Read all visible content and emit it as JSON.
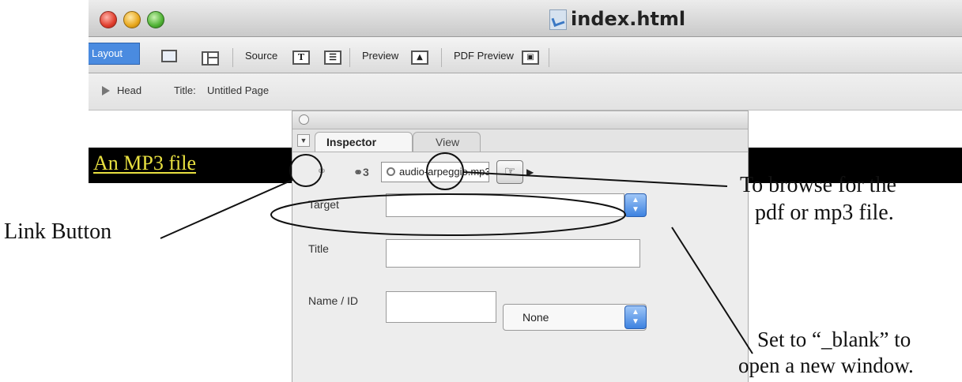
{
  "window": {
    "title": "index.html"
  },
  "toolbar": {
    "layout_label": "Layout",
    "source_label": "Source",
    "source_icon_glyph": "T",
    "preview_label": "Preview",
    "pdf_preview_label": "PDF Preview"
  },
  "headbar": {
    "head_label": "Head",
    "title_label": "Title:",
    "title_value": "Untitled Page"
  },
  "content": {
    "link_text": "An MP3 file"
  },
  "inspector": {
    "tab_inspector": "Inspector",
    "tab_view": "View",
    "url_value": "audio-arpeggio.mp3",
    "target_label": "Target",
    "target_value": "",
    "title_label": "Title",
    "title_value": "",
    "name_id_label": "Name / ID",
    "name_id_value": "",
    "name_select_value": "None"
  },
  "annotations": {
    "link_button": "Link Button",
    "browse_line1": "To browse for the",
    "browse_line2": "pdf or mp3 file.",
    "blank_line1": "Set to “_blank” to",
    "blank_line2": "open a new window."
  },
  "colors": {
    "link_text": "#e8e040",
    "content_bar": "#000000",
    "layout_tab": "#4a8be0",
    "stepper": "#3d82e0"
  },
  "icons": {
    "link_button": "link-icon",
    "unlink_button": "unlink-icon",
    "browse_button": "hand-pointer-icon",
    "url_field": "globe-icon"
  }
}
